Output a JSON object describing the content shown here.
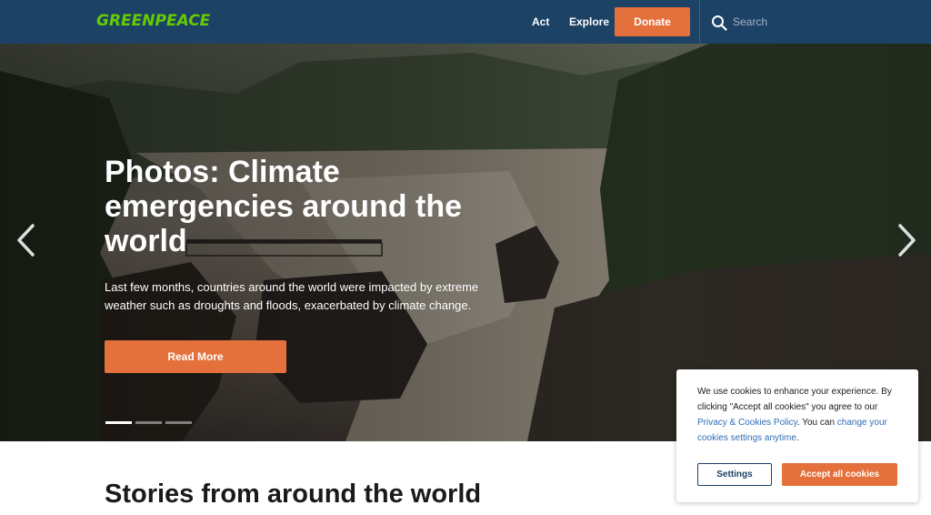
{
  "header": {
    "logo": "GREENPEACE",
    "nav": {
      "act": "Act",
      "explore": "Explore"
    },
    "donate_label": "Donate",
    "search": {
      "placeholder": "Search",
      "icon": "search-icon"
    }
  },
  "hero": {
    "title": "Photos: Climate emergencies around the world",
    "description": "Last few months, countries around the world were impacted by extreme weather such as droughts and floods, exacerbated by climate change.",
    "read_more_label": "Read More",
    "arrows": {
      "prev": "chevron-left-icon",
      "next": "chevron-right-icon"
    },
    "slides": {
      "count": 3,
      "active": 1
    }
  },
  "section": {
    "title": "Stories from around the world"
  },
  "cookie_banner": {
    "text_1": "We use cookies to enhance your experience. By clicking \"Accept all cookies\" you agree to our ",
    "privacy_link": "Privacy & Cookies Policy",
    "text_2": ". You can ",
    "settings_link": "change your cookies settings anytime",
    "text_3": ".",
    "settings_label": "Settings",
    "accept_label": "Accept all cookies"
  },
  "colors": {
    "header_bg": "#1c4266",
    "accent": "#e4703b",
    "logo": "#66cc00",
    "link": "#2f6db5"
  }
}
